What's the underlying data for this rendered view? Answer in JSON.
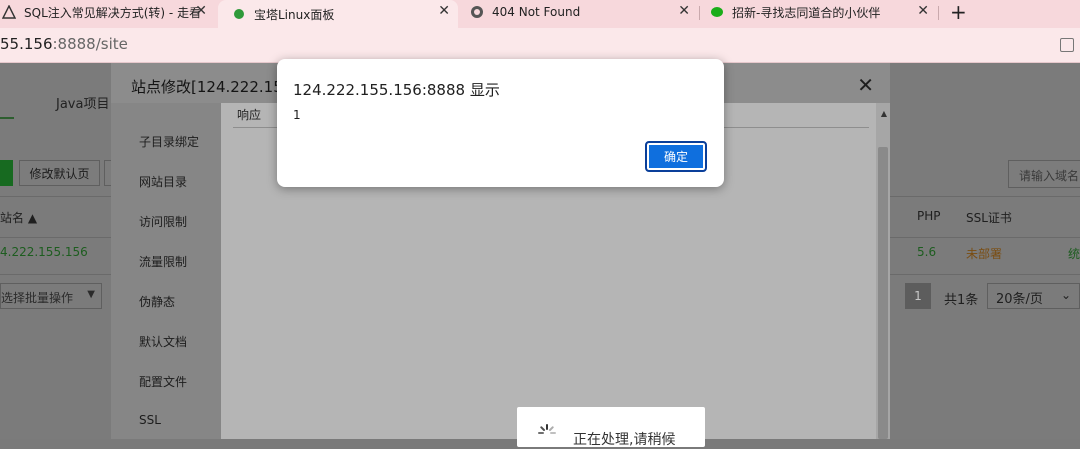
{
  "browser": {
    "tabs": [
      {
        "title": "SQL注入常见解决方式(转) - 走看",
        "active": false
      },
      {
        "title": "宝塔Linux面板",
        "active": true
      },
      {
        "title": "404 Not Found",
        "active": false
      },
      {
        "title": "招新-寻找志同道合的小伙伴",
        "active": false
      }
    ],
    "close_glyph": "✕",
    "new_tab_glyph": "+",
    "url_host": "55.156",
    "url_rest": ":8888/site"
  },
  "page": {
    "nav_tab": "Java项目",
    "buttons": [
      "修改默认页"
    ],
    "search_placeholder": "请输入域名",
    "columns": {
      "site_name": "站名 ▲",
      "php": "PHP",
      "ssl": "SSL证书"
    },
    "row": {
      "site": "4.222.155.156",
      "php": "5.6",
      "ssl": "未部署",
      "extra": "统"
    },
    "batch_select": "选择批量操作",
    "pager": {
      "current": "1",
      "total": "共1条",
      "page_size": "20条/页"
    }
  },
  "modal": {
    "title": "站点修改[124.222.155.",
    "menu": [
      "子目录绑定",
      "网站目录",
      "访问限制",
      "流量限制",
      "伪静态",
      "默认文档",
      "配置文件",
      "SSL"
    ],
    "tab": "响应",
    "loading_text": "正在处理,请稍候"
  },
  "alert": {
    "title": "124.222.155.156:8888 显示",
    "message": "1",
    "ok_label": "确定"
  }
}
